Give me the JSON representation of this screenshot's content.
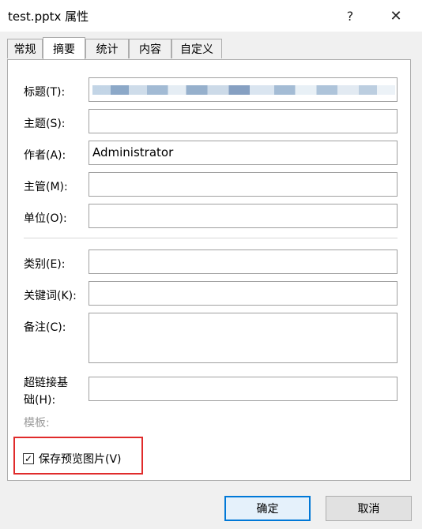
{
  "window": {
    "title": "test.pptx 属性",
    "help_glyph": "?",
    "close_glyph": "✕"
  },
  "tabs": [
    {
      "label": "常规",
      "active": false
    },
    {
      "label": "摘要",
      "active": true
    },
    {
      "label": "统计",
      "active": false
    },
    {
      "label": "内容",
      "active": false
    },
    {
      "label": "自定义",
      "active": false
    }
  ],
  "fields": {
    "title": {
      "label": "标题(T):",
      "value": ""
    },
    "subject": {
      "label": "主题(S):",
      "value": ""
    },
    "author": {
      "label": "作者(A):",
      "value": "Administrator"
    },
    "manager": {
      "label": "主管(M):",
      "value": ""
    },
    "company": {
      "label": "单位(O):",
      "value": ""
    },
    "category": {
      "label": "类别(E):",
      "value": ""
    },
    "keywords": {
      "label": "关键词(K):",
      "value": ""
    },
    "comments": {
      "label": "备注(C):",
      "value": ""
    },
    "hyperlink_base": {
      "label_line1": "超链接基",
      "label_line2": "础(H):",
      "value": ""
    },
    "template": {
      "label": "模板:"
    }
  },
  "save_preview": {
    "label": "保存预览图片(V)",
    "checked": true,
    "check_glyph": "✓"
  },
  "buttons": {
    "ok": "确定",
    "cancel": "取消"
  },
  "colors": {
    "accent": "#0078d7",
    "highlight": "#e02b2b"
  }
}
